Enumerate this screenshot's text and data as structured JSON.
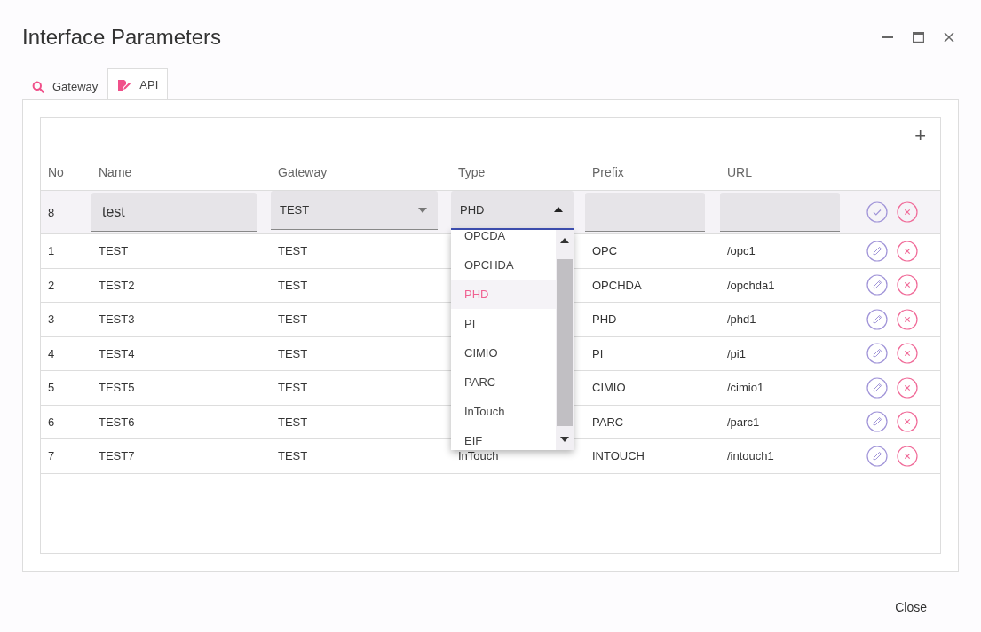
{
  "window": {
    "title": "Interface Parameters"
  },
  "tabs": [
    {
      "label": "Gateway",
      "selected": false
    },
    {
      "label": "API",
      "selected": true
    }
  ],
  "table": {
    "add_button": "+",
    "columns": [
      "No",
      "Name",
      "Gateway",
      "Type",
      "Prefix",
      "URL"
    ],
    "edit_row": {
      "no": "8",
      "name": "test",
      "gateway": "TEST",
      "type": "PHD",
      "type_expanded": true
    },
    "type_options": [
      {
        "label": "OPCDA",
        "selected": false
      },
      {
        "label": "OPCHDA",
        "selected": false
      },
      {
        "label": "PHD",
        "selected": true
      },
      {
        "label": "PI",
        "selected": false
      },
      {
        "label": "CIMIO",
        "selected": false
      },
      {
        "label": "PARC",
        "selected": false
      },
      {
        "label": "InTouch",
        "selected": false
      },
      {
        "label": "EIF",
        "selected": false
      }
    ],
    "rows": [
      {
        "no": "1",
        "name": "TEST",
        "gateway": "TEST",
        "prefix": "OPC",
        "url": "/opc1"
      },
      {
        "no": "2",
        "name": "TEST2",
        "gateway": "TEST",
        "prefix": "OPCHDA",
        "url": "/opchda1"
      },
      {
        "no": "3",
        "name": "TEST3",
        "gateway": "TEST",
        "prefix": "PHD",
        "url": "/phd1"
      },
      {
        "no": "4",
        "name": "TEST4",
        "gateway": "TEST",
        "prefix": "PI",
        "url": "/pi1"
      },
      {
        "no": "5",
        "name": "TEST5",
        "gateway": "TEST",
        "prefix": "CIMIO",
        "url": "/cimio1"
      },
      {
        "no": "6",
        "name": "TEST6",
        "gateway": "TEST",
        "prefix": "PARC",
        "url": "/parc1"
      },
      {
        "no": "7",
        "name": "TEST7",
        "gateway": "TEST",
        "type": "InTouch",
        "prefix": "INTOUCH",
        "url": "/intouch1"
      }
    ]
  },
  "buttons": [
    "Close"
  ]
}
